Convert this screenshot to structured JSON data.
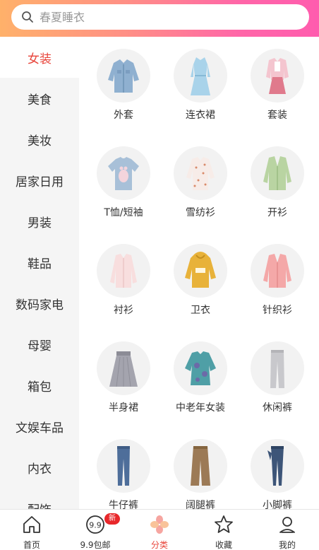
{
  "search": {
    "placeholder": "春夏睡衣"
  },
  "sidebar": {
    "items": [
      {
        "label": "女装",
        "active": true
      },
      {
        "label": "美食"
      },
      {
        "label": "美妆"
      },
      {
        "label": "居家日用"
      },
      {
        "label": "男装"
      },
      {
        "label": "鞋品"
      },
      {
        "label": "数码家电"
      },
      {
        "label": "母婴"
      },
      {
        "label": "箱包"
      },
      {
        "label": "文娱车品"
      },
      {
        "label": "内衣"
      },
      {
        "label": "配饰"
      }
    ]
  },
  "categories": [
    {
      "label": "外套",
      "icon": "denim-jacket-icon"
    },
    {
      "label": "连衣裙",
      "icon": "dress-icon"
    },
    {
      "label": "套装",
      "icon": "suit-set-icon"
    },
    {
      "label": "T恤/短袖",
      "icon": "tshirt-icon"
    },
    {
      "label": "雪纺衫",
      "icon": "chiffon-shirt-icon"
    },
    {
      "label": "开衫",
      "icon": "cardigan-icon"
    },
    {
      "label": "衬衫",
      "icon": "shirt-icon"
    },
    {
      "label": "卫衣",
      "icon": "hoodie-icon"
    },
    {
      "label": "针织衫",
      "icon": "knit-sweater-icon"
    },
    {
      "label": "半身裙",
      "icon": "skirt-icon"
    },
    {
      "label": "中老年女装",
      "icon": "senior-blouse-icon"
    },
    {
      "label": "休闲裤",
      "icon": "casual-pants-icon"
    },
    {
      "label": "牛仔裤",
      "icon": "jeans-icon"
    },
    {
      "label": "阔腿裤",
      "icon": "wide-leg-pants-icon"
    },
    {
      "label": "小脚裤",
      "icon": "skinny-pants-icon"
    }
  ],
  "tabbar": {
    "tabs": [
      {
        "label": "首页",
        "icon": "home-icon"
      },
      {
        "label": "9.9包邮",
        "icon": "nine-nine-icon",
        "badge": "新"
      },
      {
        "label": "分类",
        "icon": "category-icon",
        "active": true
      },
      {
        "label": "收藏",
        "icon": "star-icon"
      },
      {
        "label": "我的",
        "icon": "user-icon"
      }
    ]
  },
  "colors": {
    "accent": "#e8443a",
    "header_gradient_start": "#ffb16a",
    "header_gradient_end": "#ff5cae",
    "badge": "#e8282b"
  }
}
